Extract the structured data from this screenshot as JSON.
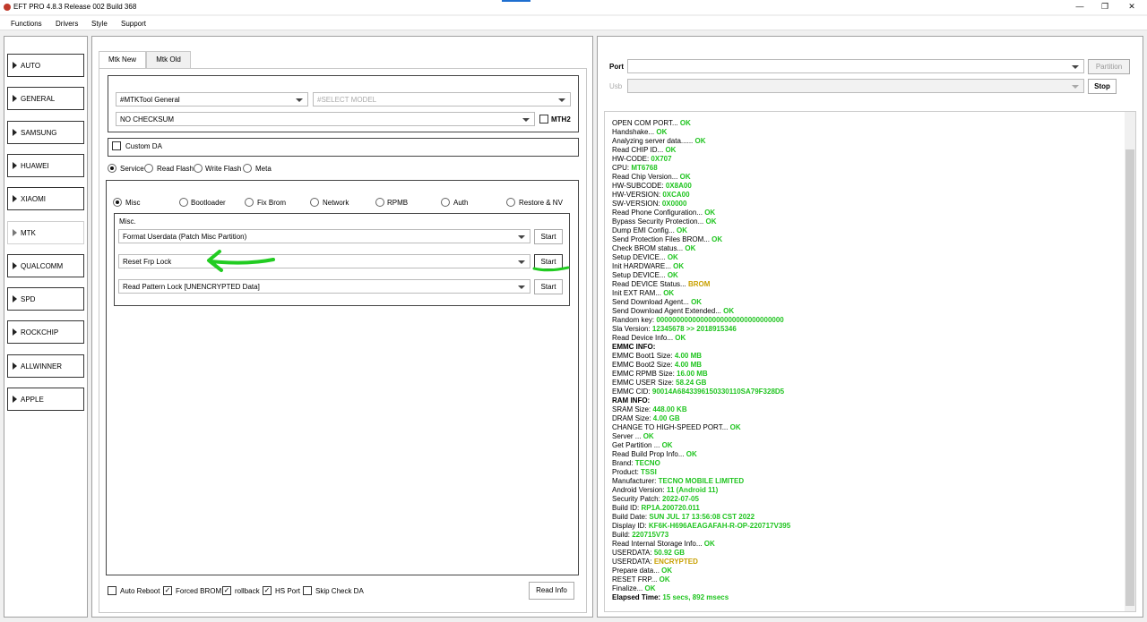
{
  "window": {
    "title": "EFT PRO 4.8.3 Release 002 Build 368",
    "minimize": "—",
    "restore": "❐",
    "close": "✕"
  },
  "menu": [
    "Functions",
    "Drivers",
    "Style",
    "Support"
  ],
  "sidebar": [
    "AUTO",
    "GENERAL",
    "SAMSUNG",
    "HUAWEI",
    "XIAOMI",
    "MTK",
    "QUALCOMM",
    "SPD",
    "ROCKCHIP",
    "ALLWINNER",
    "APPLE"
  ],
  "sidebar_active": "MTK",
  "tabs": [
    "Mtk New",
    "Mtk Old"
  ],
  "tool_select": "#MTKTool General",
  "model_select": "#SELECT MODEL",
  "checksum_select": "NO CHECKSUM",
  "mth2_label": "MTH2",
  "custom_da_label": "Custom DA",
  "modes": [
    "Service",
    "Read Flash",
    "Write Flash",
    "Meta"
  ],
  "categories": [
    "Misc",
    "Bootloader",
    "Fix Brom",
    "Network",
    "RPMB",
    "Auth",
    "Restore & NV"
  ],
  "misc_group_label": "Misc.",
  "operations": [
    "Format Userdata (Patch Misc Partition)",
    "Reset Frp Lock",
    "Read Pattern Lock [UNENCRYPTED Data]"
  ],
  "start_label": "Start",
  "footer_options": [
    "Auto Reboot",
    "Forced BROM",
    "rollback",
    "HS Port",
    "Skip Check DA"
  ],
  "footer_checked": [
    false,
    true,
    true,
    true,
    false
  ],
  "read_info_label": "Read Info",
  "port_label": "Port",
  "usb_label": "Usb",
  "partition_label": "Partition",
  "stop_label": "Stop",
  "log": [
    {
      "t": "OPEN COM PORT... ",
      "v": "OK"
    },
    {
      "t": "Handshake... ",
      "v": "OK"
    },
    {
      "t": "Analyzing server data...... ",
      "v": "OK"
    },
    {
      "t": "Read CHIP ID... ",
      "v": "OK"
    },
    {
      "t": "HW-CODE: ",
      "v": "0X707"
    },
    {
      "t": "CPU: ",
      "v": "MT6768"
    },
    {
      "t": "Read Chip Version... ",
      "v": "OK"
    },
    {
      "t": "HW-SUBCODE: ",
      "v": "0X8A00"
    },
    {
      "t": "HW-VERSION: ",
      "v": "0XCA00"
    },
    {
      "t": "SW-VERSION: ",
      "v": "0X0000"
    },
    {
      "t": "Read Phone Configuration... ",
      "v": "OK"
    },
    {
      "t": "Bypass Security Protection... ",
      "v": "OK"
    },
    {
      "t": "Dump EMI Config... ",
      "v": "OK"
    },
    {
      "t": "Send Protection Files BROM... ",
      "v": "OK"
    },
    {
      "t": "Check BROM status... ",
      "v": "OK"
    },
    {
      "t": "Setup DEVICE... ",
      "v": "OK"
    },
    {
      "t": "Init HARDWARE... ",
      "v": "OK"
    },
    {
      "t": "Setup DEVICE... ",
      "v": "OK"
    },
    {
      "t": "Read DEVICE Status... ",
      "v": "BROM",
      "c": "vo"
    },
    {
      "t": "Init EXT RAM... ",
      "v": "OK"
    },
    {
      "t": "Send Download Agent... ",
      "v": "OK"
    },
    {
      "t": "Send Download Agent Extended... ",
      "v": "OK"
    },
    {
      "t": "Random key:  ",
      "v": "00000000000000000000000000000000"
    },
    {
      "t": "Sla Version:  ",
      "v": "12345678 >> 2018915346"
    },
    {
      "t": "Read Device Info... ",
      "v": "OK"
    },
    {
      "t": "EMMC INFO:",
      "b": true
    },
    {
      "t": "EMMC Boot1 Size: ",
      "v": "4.00 MB"
    },
    {
      "t": "EMMC Boot2 Size: ",
      "v": "4.00 MB"
    },
    {
      "t": "EMMC RPMB Size: ",
      "v": "16.00 MB"
    },
    {
      "t": "EMMC USER Size: ",
      "v": "58.24 GB"
    },
    {
      "t": "EMMC CID: ",
      "v": "90014A6843396150330110SA79F328D5"
    },
    {
      "t": "RAM INFO:",
      "b": true
    },
    {
      "t": "SRAM Size: ",
      "v": "448.00 KB"
    },
    {
      "t": "DRAM Size: ",
      "v": "4.00 GB"
    },
    {
      "t": "CHANGE TO HIGH-SPEED PORT... ",
      "v": "OK"
    },
    {
      "t": "Server ... ",
      "v": "OK"
    },
    {
      "t": "Get Partition ... ",
      "v": "OK"
    },
    {
      "t": "Read Build Prop Info... ",
      "v": "OK"
    },
    {
      "t": " Brand: ",
      "v": "TECNO"
    },
    {
      "t": " Product: ",
      "v": "TSSI"
    },
    {
      "t": " Manufacturer: ",
      "v": "TECNO MOBILE LIMITED"
    },
    {
      "t": " Android Version: ",
      "v": "11 (Android 11)"
    },
    {
      "t": " Security Patch: ",
      "v": "2022-07-05"
    },
    {
      "t": " Build ID: ",
      "v": "RP1A.200720.011"
    },
    {
      "t": " Build Date: ",
      "v": "SUN JUL 17 13:56:08 CST 2022"
    },
    {
      "t": " Display ID: ",
      "v": "KF6K-H696AEAGAFAH-R-OP-220717V395"
    },
    {
      "t": " Build: ",
      "v": "220715V73"
    },
    {
      "t": "Read Internal Storage Info... ",
      "v": "OK"
    },
    {
      "t": "USERDATA: ",
      "v": "50.92 GB"
    },
    {
      "t": "USERDATA: ",
      "v": "ENCRYPTED",
      "c": "vo"
    },
    {
      "t": "Prepare data... ",
      "v": "OK"
    },
    {
      "t": "RESET FRP... ",
      "v": "OK"
    },
    {
      "t": "Finalize... ",
      "v": "OK"
    },
    {
      "t": "Elapsed Time: ",
      "v": "15 secs, 892 msecs",
      "b": true,
      "c": "vg"
    }
  ]
}
